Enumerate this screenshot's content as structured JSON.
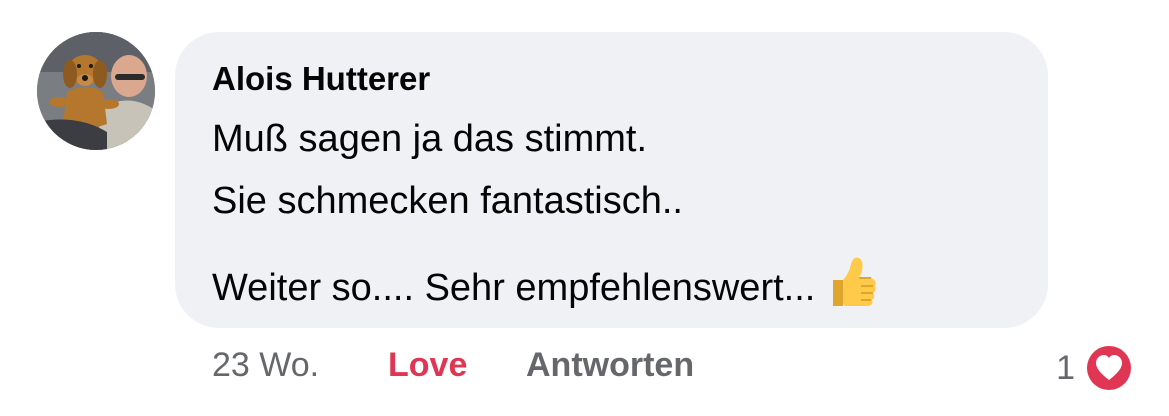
{
  "comment": {
    "author": "Alois Hutterer",
    "lines": [
      "Muß sagen ja das stimmt.",
      "Sie schmecken fantastisch..",
      "Weiter so.... Sehr empfehlenswert..."
    ],
    "emoji": "thumbs-up-icon",
    "avatar": "user-avatar-with-dog"
  },
  "actions": {
    "timestamp": "23 Wo.",
    "love_label": "Love",
    "reply_label": "Antworten"
  },
  "reactions": {
    "count": "1",
    "icon": "heart-icon",
    "color": "#e03553"
  },
  "colors": {
    "bubble": "#f0f1f4",
    "text": "#050505",
    "secondary": "#65676b",
    "love": "#e03553"
  }
}
